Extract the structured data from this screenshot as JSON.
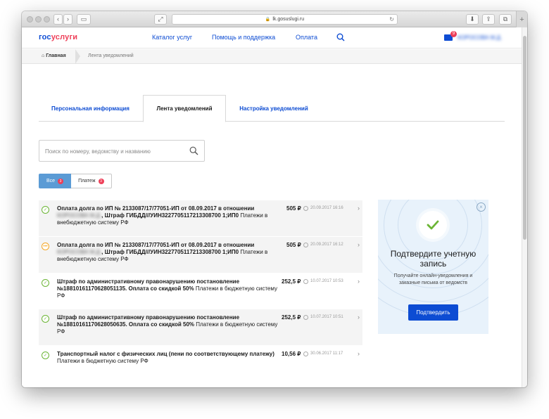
{
  "browser": {
    "url": "lk.gosuslugi.ru"
  },
  "header": {
    "logo_main": "гос",
    "logo_accent": "услуги",
    "nav": [
      "Каталог услуг",
      "Помощь и поддержка",
      "Оплата"
    ],
    "mail_count": "9",
    "user_name": "КОРОСОВА М.Д."
  },
  "breadcrumb": {
    "home": "Главная",
    "current": "Лента уведомлений"
  },
  "tabs": [
    {
      "label": "Персональная информация",
      "active": false
    },
    {
      "label": "Лента уведомлений",
      "active": true
    },
    {
      "label": "Настройка уведомлений",
      "active": false
    }
  ],
  "search": {
    "placeholder": "Поиск по номеру, ведомству и названию",
    "value": ""
  },
  "filters": [
    {
      "label": "Все",
      "count": "3",
      "active": true
    },
    {
      "label": "Платеж",
      "count": "3",
      "active": false
    }
  ],
  "notifications": [
    {
      "status": "done",
      "title_a": "Оплата долга по ИП № 2133087/17/77051-ИП от 08.09.2017 в отношении",
      "hidden_name": "КОРОСОВА М.Д.",
      "title_b": ", Штраф ГИБДД///УИН3227705117213308700 1;ИП0",
      "subtitle": "Платежи в внебюджетную систему РФ",
      "amount": "505 ₽",
      "date": "20.09.2017 16:16"
    },
    {
      "status": "pending",
      "title_a": "Оплата долга по ИП № 2133087/17/77051-ИП от 08.09.2017 в отношении",
      "hidden_name": "КОРОСОВА М.Д.",
      "title_b": ", Штраф ГИБДД///УИН3227705117213308700 1;ИП0",
      "subtitle": "Платежи в внебюджетную систему РФ",
      "amount": "505 ₽",
      "date": "20.09.2017 16:12"
    },
    {
      "status": "done",
      "title_a": "Штраф по административному правонарушению постановление №18810161170628051135. Оплата со скидкой 50%",
      "hidden_name": "",
      "title_b": "",
      "subtitle": "Платежи в бюджетную систему РФ",
      "amount": "252,5 ₽",
      "date": "10.07.2017 10:53"
    },
    {
      "status": "done",
      "title_a": "Штраф по административному правонарушению постановление №18810161170628050635. Оплата со скидкой 50%",
      "hidden_name": "",
      "title_b": "",
      "subtitle": "Платежи в бюджетную систему РФ",
      "amount": "252,5 ₽",
      "date": "10.07.2017 10:51"
    },
    {
      "status": "done",
      "title_a": "Транспортный налог с физических лиц (пени по соответствующему платежу)",
      "hidden_name": "",
      "title_b": "",
      "subtitle": "Платежи в бюджетную систему РФ",
      "amount": "10,56 ₽",
      "date": "30.06.2017 11:17"
    }
  ],
  "promo": {
    "title": "Подтвердите учетную запись",
    "description": "Получайте онлайн-уведомления и заказные письма от ведомств",
    "button": "Подтвердить"
  },
  "colors": {
    "brand_blue": "#0d4cd3",
    "brand_red": "#ee3f58",
    "success_green": "#6bb535",
    "pending_orange": "#f5a623",
    "filter_active": "#5b9bd5",
    "promo_bg": "#e8f2fb"
  }
}
